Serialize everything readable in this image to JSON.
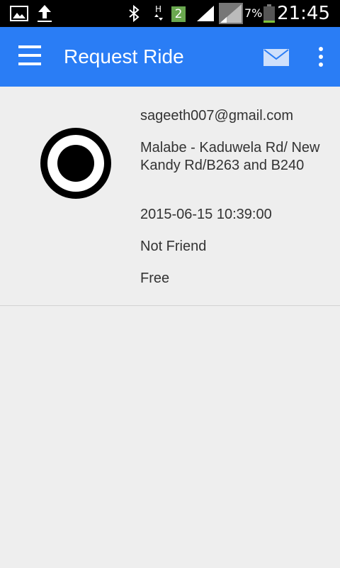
{
  "status_bar": {
    "notification_badge": "2",
    "battery_percent": "7%",
    "time": "21:45",
    "icons": [
      "image-icon",
      "upload-icon",
      "bluetooth-icon",
      "hspa-data-icon",
      "signal-icon",
      "signal-icon",
      "battery-icon"
    ]
  },
  "app_bar": {
    "title": "Request Ride",
    "color": "#2a7df5",
    "icons": [
      "menu-icon",
      "mail-icon",
      "more-vert-icon"
    ]
  },
  "ride": {
    "email": "sageeth007@gmail.com",
    "location": "Malabe - Kaduwela Rd/ New Kandy Rd/B263 and B240",
    "datetime": "2015-06-15 10:39:00",
    "friend_status": "Not Friend",
    "price": "Free",
    "avatar_icon": "target-icon"
  }
}
